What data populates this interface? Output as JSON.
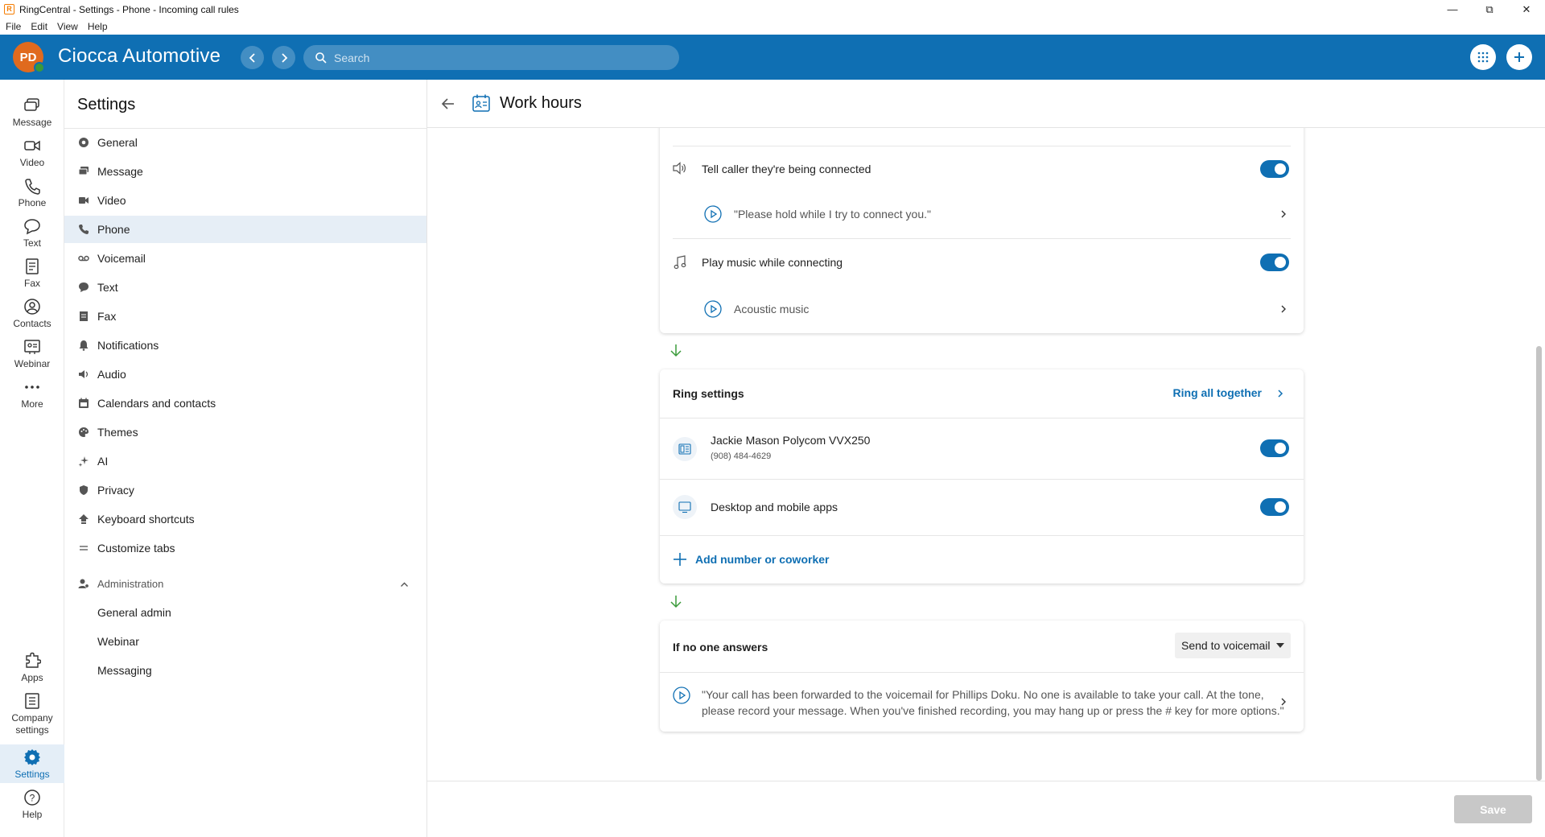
{
  "window": {
    "title": "RingCentral - Settings - Phone - Incoming call rules",
    "menu": [
      "File",
      "Edit",
      "View",
      "Help"
    ]
  },
  "header": {
    "avatar_initials": "PD",
    "company": "Ciocca Automotive",
    "search_placeholder": "Search"
  },
  "rail": {
    "items": [
      {
        "label": "Message",
        "icon": "message-icon"
      },
      {
        "label": "Video",
        "icon": "video-icon"
      },
      {
        "label": "Phone",
        "icon": "phone-icon"
      },
      {
        "label": "Text",
        "icon": "text-icon"
      },
      {
        "label": "Fax",
        "icon": "fax-icon"
      },
      {
        "label": "Contacts",
        "icon": "contacts-icon"
      },
      {
        "label": "Webinar",
        "icon": "webinar-icon"
      },
      {
        "label": "More",
        "icon": "more-icon"
      }
    ],
    "bottom": [
      {
        "label": "Apps",
        "icon": "apps-icon"
      },
      {
        "label": "Company settings",
        "icon": "company-settings-icon"
      },
      {
        "label": "Settings",
        "icon": "settings-icon"
      },
      {
        "label": "Help",
        "icon": "help-icon"
      }
    ]
  },
  "settings": {
    "title": "Settings",
    "items": [
      "General",
      "Message",
      "Video",
      "Phone",
      "Voicemail",
      "Text",
      "Fax",
      "Notifications",
      "Audio",
      "Calendars and contacts",
      "Themes",
      "AI",
      "Privacy",
      "Keyboard shortcuts",
      "Customize tabs"
    ],
    "active": "Phone",
    "admin_label": "Administration",
    "admin_items": [
      "General admin",
      "Webinar",
      "Messaging"
    ]
  },
  "main": {
    "title": "Work hours",
    "connecting": {
      "tell_caller": "Tell caller they're being connected",
      "tell_caller_msg": "\"Please hold while I try to connect you.\"",
      "play_music": "Play music while connecting",
      "music": "Acoustic music"
    },
    "ring": {
      "title": "Ring settings",
      "mode": "Ring all together",
      "device_name": "Jackie Mason Polycom VVX250",
      "device_number": "(908) 484-4629",
      "apps": "Desktop and mobile apps",
      "add": "Add number or coworker"
    },
    "no_answer": {
      "title": "If no one answers",
      "action": "Send to voicemail",
      "message_line1": "\"Your call has been forwarded to the voicemail for Phillips Doku. No one is available to take your call. At the tone,",
      "message_line2": "please record your message. When you've finished recording, you may hang up or press the # key for more options.\""
    },
    "save": "Save"
  },
  "colors": {
    "brand": "#0f6fb3",
    "avatar": "#e06a1e",
    "arrow_green": "#3a9a3a"
  }
}
